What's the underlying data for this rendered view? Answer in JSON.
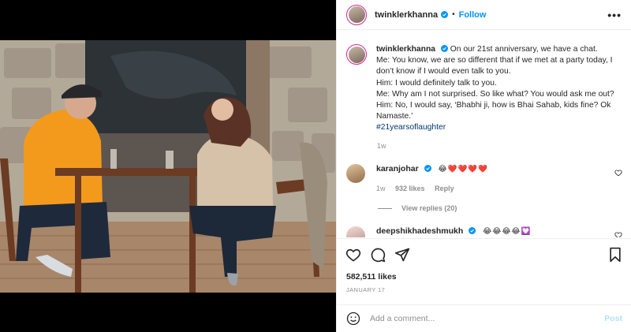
{
  "post": {
    "username": "twinklerkhanna",
    "follow_label": "Follow",
    "more_label": "•••",
    "caption": {
      "username": "twinklerkhanna",
      "lines": [
        "On our 21st anniversary, we have a chat.",
        "Me: You know, we are so different that if we met at a party today, I don’t know if I would even talk to you.",
        "Him: I would definitely talk to you.",
        "Me: Why am I not surprised. So like what? You would ask me out?",
        "Him: No, I would say, ‘Bhabhi ji, how is Bhai Sahab, kids fine? Ok Namaste.’"
      ],
      "hashtag": "#21yearsoflaughter",
      "age": "1w"
    },
    "comments": [
      {
        "username": "karanjohar",
        "text": "😂❤️❤️❤️❤️",
        "age": "1w",
        "likes": "932 likes",
        "reply_label": "Reply",
        "view_replies": "View replies (20)"
      },
      {
        "username": "deepshikhadeshmukh",
        "text": "😂😂😂😂💟"
      }
    ],
    "likes": "582,511 likes",
    "date": "JANUARY 17",
    "add_comment_placeholder": "Add a comment...",
    "post_button": "Post",
    "icons": [
      "heart-icon",
      "comment-icon",
      "share-icon",
      "save-icon",
      "emoji-icon",
      "verified-icon",
      "more-icon"
    ],
    "colors": {
      "link": "#0095f6",
      "hashtag": "#00376b",
      "heart": "#ed4956",
      "secondary": "#8e8e8e"
    }
  }
}
